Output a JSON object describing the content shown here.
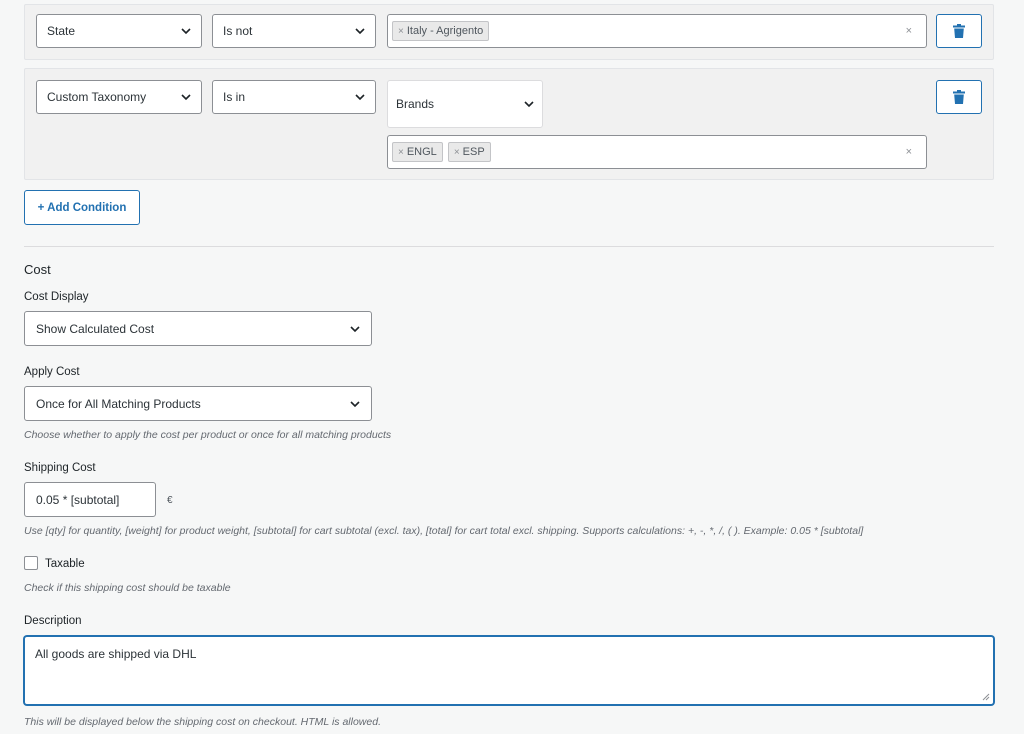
{
  "conditions": [
    {
      "field": "State",
      "operator": "Is not",
      "values": [
        "Italy - Agrigento"
      ]
    },
    {
      "field": "Custom Taxonomy",
      "operator": "Is in",
      "taxonomy": "Brands",
      "values": [
        "ENGL",
        "ESP"
      ]
    }
  ],
  "chip_remove_glyph": "×",
  "clear_glyph": "×",
  "add_condition_label": "+ Add Condition",
  "cost": {
    "heading": "Cost",
    "display_label": "Cost Display",
    "display_value": "Show Calculated Cost",
    "apply_label": "Apply Cost",
    "apply_value": "Once for All Matching Products",
    "apply_help": "Choose whether to apply the cost per product or once for all matching products",
    "shipping_label": "Shipping Cost",
    "shipping_value": "0.05 * [subtotal]",
    "currency": "€",
    "shipping_help": "Use [qty] for quantity, [weight] for product weight, [subtotal] for cart subtotal (excl. tax), [total] for cart total excl. shipping. Supports calculations: +, -, *, /, ( ). Example: 0.05 * [subtotal]",
    "taxable_label": "Taxable",
    "taxable_checked": false,
    "taxable_help": "Check if this shipping cost should be taxable",
    "description_label": "Description",
    "description_value": "All goods are shipped via DHL",
    "description_help": "This will be displayed below the shipping cost on checkout. HTML is allowed."
  },
  "colors": {
    "accent": "#2271b1",
    "panel_bg": "#f1f1f1",
    "page_bg": "#f6f7f7"
  }
}
